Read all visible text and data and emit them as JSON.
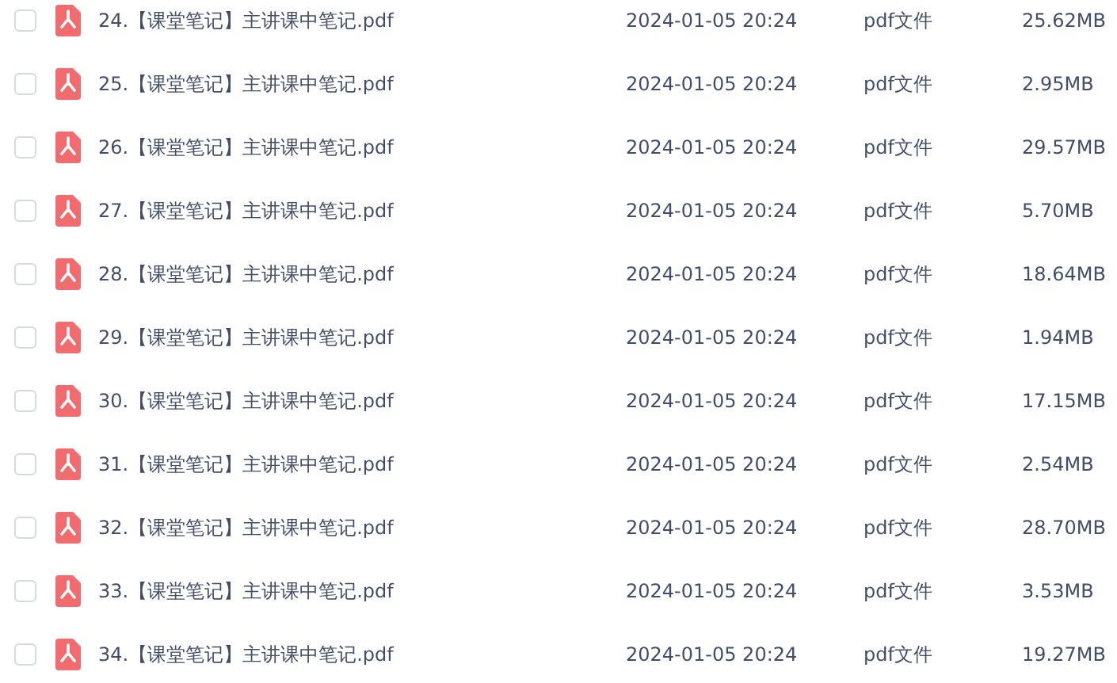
{
  "files": [
    {
      "checked": false,
      "name": "24.【课堂笔记】主讲课中笔记.pdf",
      "date": "2024-01-05 20:24",
      "type": "pdf文件",
      "size": "25.62MB"
    },
    {
      "checked": false,
      "name": "25.【课堂笔记】主讲课中笔记.pdf",
      "date": "2024-01-05 20:24",
      "type": "pdf文件",
      "size": "2.95MB"
    },
    {
      "checked": false,
      "name": "26.【课堂笔记】主讲课中笔记.pdf",
      "date": "2024-01-05 20:24",
      "type": "pdf文件",
      "size": "29.57MB"
    },
    {
      "checked": false,
      "name": "27.【课堂笔记】主讲课中笔记.pdf",
      "date": "2024-01-05 20:24",
      "type": "pdf文件",
      "size": "5.70MB"
    },
    {
      "checked": false,
      "name": "28.【课堂笔记】主讲课中笔记.pdf",
      "date": "2024-01-05 20:24",
      "type": "pdf文件",
      "size": "18.64MB"
    },
    {
      "checked": false,
      "name": "29.【课堂笔记】主讲课中笔记.pdf",
      "date": "2024-01-05 20:24",
      "type": "pdf文件",
      "size": "1.94MB"
    },
    {
      "checked": false,
      "name": "30.【课堂笔记】主讲课中笔记.pdf",
      "date": "2024-01-05 20:24",
      "type": "pdf文件",
      "size": "17.15MB"
    },
    {
      "checked": false,
      "name": "31.【课堂笔记】主讲课中笔记.pdf",
      "date": "2024-01-05 20:24",
      "type": "pdf文件",
      "size": "2.54MB"
    },
    {
      "checked": false,
      "name": "32.【课堂笔记】主讲课中笔记.pdf",
      "date": "2024-01-05 20:24",
      "type": "pdf文件",
      "size": "28.70MB"
    },
    {
      "checked": false,
      "name": "33.【课堂笔记】主讲课中笔记.pdf",
      "date": "2024-01-05 20:24",
      "type": "pdf文件",
      "size": "3.53MB"
    },
    {
      "checked": false,
      "name": "34.【课堂笔记】主讲课中笔记.pdf",
      "date": "2024-01-05 20:24",
      "type": "pdf文件",
      "size": "19.27MB"
    }
  ]
}
